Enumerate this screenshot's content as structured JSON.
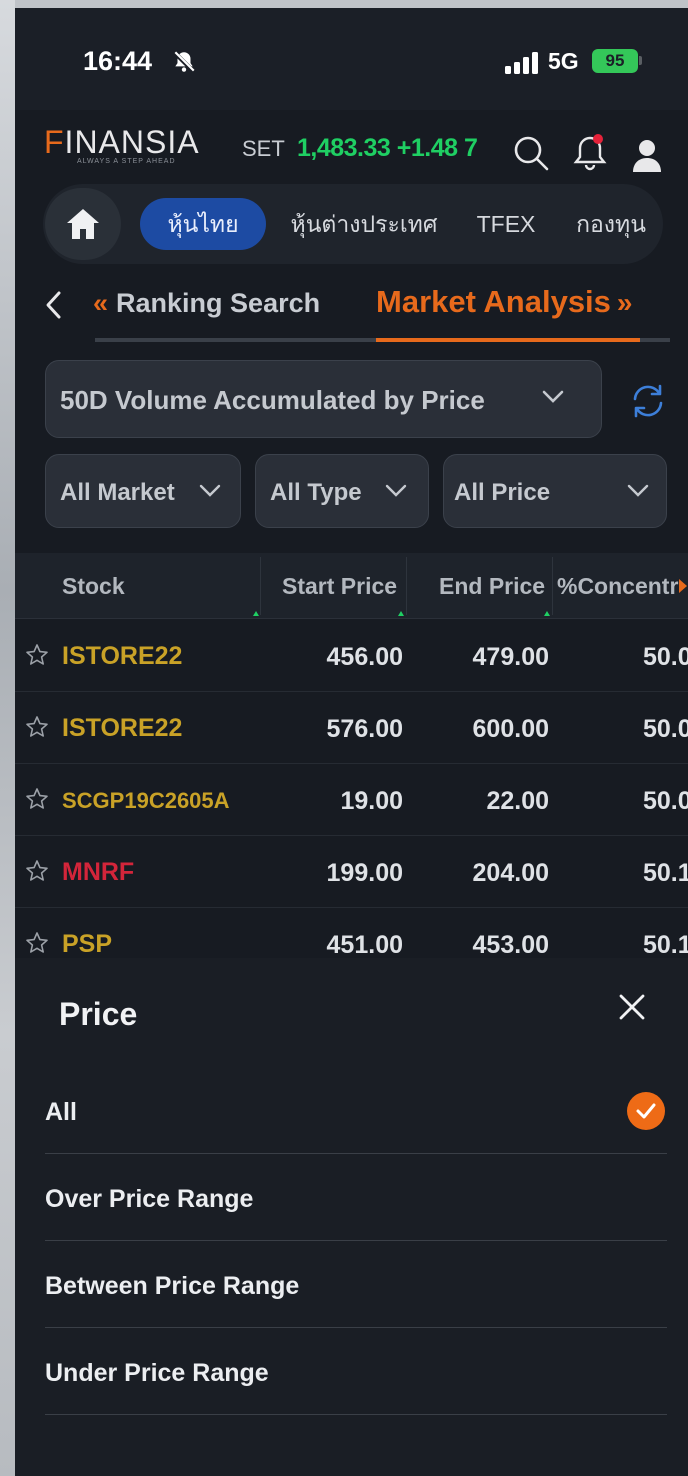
{
  "status_bar": {
    "time": "16:44",
    "network": "5G",
    "battery": "95"
  },
  "header": {
    "logo": "FINANSIA",
    "logo_first_letter": "F",
    "logo_rest": "INANSIA",
    "tagline": "ALWAYS A STEP AHEAD",
    "index_name": "SET",
    "index_value": "1,483.33 +1.48 7",
    "icons": [
      "search-icon",
      "bell-icon",
      "user-icon"
    ],
    "colors": {
      "accent": "#e76a1c",
      "up": "#1fcf63"
    }
  },
  "category_nav": {
    "items": [
      "หุ้นไทย",
      "หุ้นต่างประเทศ",
      "TFEX",
      "กองทุน"
    ],
    "active_index": 0
  },
  "section_tabs": {
    "prev": "Ranking Search",
    "active": "Market Analysis",
    "prev_arrows": "«",
    "next_arrows": "»"
  },
  "filters": {
    "analysis_type": "50D Volume Accumulated by Price",
    "market": "All Market",
    "type": "All Type",
    "price": "All Price"
  },
  "table": {
    "columns": [
      "Stock",
      "Start Price",
      "End Price",
      "%Concentr"
    ],
    "rows": [
      {
        "symbol": "ISTORE22",
        "start": "456.00",
        "end": "479.00",
        "conc": "50.0",
        "color": "#c9a227"
      },
      {
        "symbol": "ISTORE22",
        "start": "576.00",
        "end": "600.00",
        "conc": "50.0",
        "color": "#c9a227"
      },
      {
        "symbol": "SCGP19C2605A",
        "start": "19.00",
        "end": "22.00",
        "conc": "50.0",
        "color": "#c9a227"
      },
      {
        "symbol": "MNRF",
        "start": "199.00",
        "end": "204.00",
        "conc": "50.1",
        "color": "#d3253a"
      },
      {
        "symbol": "PSP",
        "start": "451.00",
        "end": "453.00",
        "conc": "50.1",
        "color": "#c9a227"
      }
    ]
  },
  "price_sheet": {
    "title": "Price",
    "options": [
      "All",
      "Over Price Range",
      "Between Price Range",
      "Under Price Range"
    ],
    "selected_index": 0
  }
}
